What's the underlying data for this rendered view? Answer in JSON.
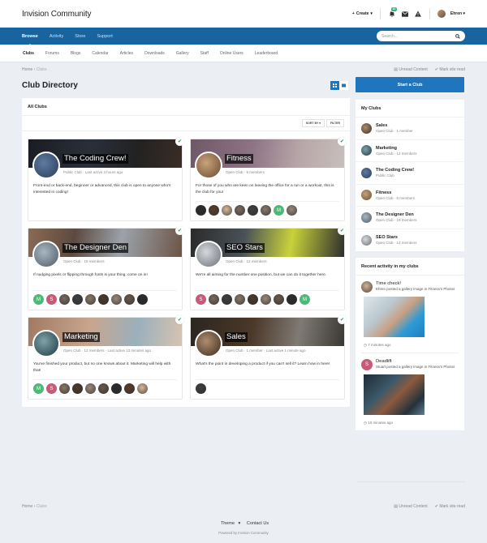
{
  "header": {
    "site_title": "Invision Community",
    "create_label": "Create",
    "notification_count": "10",
    "user_name": "Ehren"
  },
  "nav_primary": {
    "items": [
      "Browse",
      "Activity",
      "Store",
      "Support"
    ],
    "active": "Browse",
    "search_placeholder": "Search..."
  },
  "nav_secondary": {
    "items": [
      "Clubs",
      "Forums",
      "Blogs",
      "Calendar",
      "Articles",
      "Downloads",
      "Gallery",
      "Staff",
      "Online Users",
      "Leaderboard"
    ],
    "active": "Clubs"
  },
  "breadcrumb": {
    "home": "Home",
    "separator": "›",
    "current": "Clubs",
    "unread_content": "Unread Content",
    "mark_site_read": "Mark site read"
  },
  "page": {
    "title": "Club Directory",
    "start_club_label": "Start a Club"
  },
  "all_clubs": {
    "heading": "All Clubs",
    "sort_by_label": "SORT BY",
    "filter_label": "FILTER",
    "clubs": [
      {
        "name": "The Coding Crew!",
        "meta": "Public Club  ·  Last active 3 hours ago",
        "description": "Front-end or back-end, beginner or advanced, this club is open to anyone who's interested in coding!",
        "joined": true,
        "members": []
      },
      {
        "name": "Fitness",
        "meta": "Open Club  ·  8 members",
        "description": "For those of you who are keen on leaving the office for a run or a workout, this is the club for you!",
        "joined": true,
        "members": [
          "photo",
          "photo",
          "photo",
          "photo",
          "photo",
          "photo",
          "M",
          "photo"
        ]
      },
      {
        "name": "The Designer Den",
        "meta": "Open Club  ·  19 members",
        "description": "If nudging pixels or flipping through fonts is your thing, come on in!",
        "joined": true,
        "members": [
          "M",
          "S",
          "photo",
          "photo",
          "photo",
          "photo",
          "photo",
          "photo",
          "photo"
        ]
      },
      {
        "name": "SEO Stars",
        "meta": "Open Club  ·  12 members",
        "description": "We're all aiming for the number one position, but we can do it together here.",
        "joined": true,
        "members": [
          "S",
          "photo",
          "photo",
          "photo",
          "photo",
          "photo",
          "photo",
          "photo",
          "M"
        ]
      },
      {
        "name": "Marketing",
        "meta": "Open Club  ·  12 members  ·  Last active 13 minutes ago",
        "description": "You've finished your product, but no one knows about it. Marketing will help with that!",
        "joined": true,
        "members": [
          "M",
          "S",
          "photo",
          "photo",
          "photo",
          "photo",
          "photo",
          "photo",
          "photo"
        ]
      },
      {
        "name": "Sales",
        "meta": "Open Club  ·  1 member  ·  Last active 1 minute ago",
        "description": "What's the point in developing a product if you can't sell it? Learn how in here!",
        "joined": true,
        "members": [
          "photo"
        ]
      }
    ]
  },
  "my_clubs": {
    "heading": "My Clubs",
    "items": [
      {
        "name": "Sales",
        "meta": "Open Club  ·  1 member"
      },
      {
        "name": "Marketing",
        "meta": "Open Club  ·  12 members"
      },
      {
        "name": "The Coding Crew!",
        "meta": "Public Club"
      },
      {
        "name": "Fitness",
        "meta": "Open Club  ·  8 members"
      },
      {
        "name": "The Designer Den",
        "meta": "Open Club  ·  19 members"
      },
      {
        "name": "SEO Stars",
        "meta": "Open Club  ·  12 members"
      }
    ]
  },
  "recent_activity": {
    "heading": "Recent activity in my clubs",
    "items": [
      {
        "title": "Time check!",
        "description": "Ehren posted a gallery image in Fitness's Photos",
        "time": "7 minutes ago",
        "avatar_letter": ""
      },
      {
        "title": "Deadlift",
        "description": "Stuart posted a gallery image in Fitness's Photos",
        "time": "10 minutes ago",
        "avatar_letter": "S"
      }
    ]
  },
  "footer": {
    "theme_label": "Theme",
    "contact_label": "Contact Us",
    "powered_by": "Powered by Invision Community"
  },
  "colors": {
    "brand_blue": "#17649f",
    "button_blue": "#1f75be",
    "check_green": "#3a8c5b",
    "letter_m": "#4fb878",
    "letter_s": "#c85a78"
  }
}
